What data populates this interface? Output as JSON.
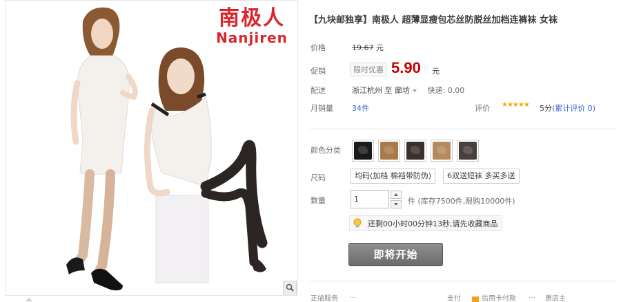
{
  "brand": {
    "name_cn": "南极人",
    "name_en": "Nanjiren"
  },
  "product": {
    "title": "【九块邮独享】南极人 超薄显瘦包芯丝防脱丝加档连裤袜 女袜"
  },
  "price": {
    "label": "价格",
    "original": "19.67",
    "unit": "元"
  },
  "promo": {
    "label": "促销",
    "tag": "限时优惠",
    "price": "5.90",
    "unit": "元"
  },
  "shipping": {
    "label": "配送",
    "origin": "浙江杭州",
    "to": "至",
    "destination": "廊坊",
    "fee": "快递: 0.00"
  },
  "sales": {
    "label": "月销量",
    "count": "34件",
    "rating_label": "评价",
    "stars": "★★★★★",
    "score": "5分",
    "review_link": "(累计评价 0)"
  },
  "colors": {
    "label": "颜色分类",
    "swatches": [
      {
        "color": "#1a1a1a",
        "name": "black"
      },
      {
        "color": "#a97a4b",
        "name": "coffee"
      },
      {
        "color": "#3a2f2c",
        "name": "dark-brown"
      },
      {
        "color": "#b68a5e",
        "name": "skin"
      },
      {
        "color": "#4a3f3e",
        "name": "grey-brown"
      }
    ]
  },
  "size": {
    "label": "尺码",
    "options": [
      "均码(加档 棉裆带防伪)",
      "6双送短袜 多买多送"
    ]
  },
  "quantity": {
    "label": "数量",
    "value": "1",
    "stock_text": "件 (库存7500件,限购10000件)"
  },
  "countdown": {
    "text": "还剩00小时00分钟13秒,请先收藏商品"
  },
  "buy_button": "即将开始",
  "bottom_strip": {
    "items": [
      "正描服务",
      "…",
      "支付",
      "信用卡付款",
      "…",
      "惠店主"
    ]
  },
  "icons": {
    "zoom": "magnifier-icon",
    "bulb": "lightbulb-icon",
    "star": "star-icon"
  },
  "accent_colors": {
    "price_red": "#c40000",
    "brand_red": "#d9252b",
    "star": "#f5a800",
    "link": "#3366cc"
  }
}
